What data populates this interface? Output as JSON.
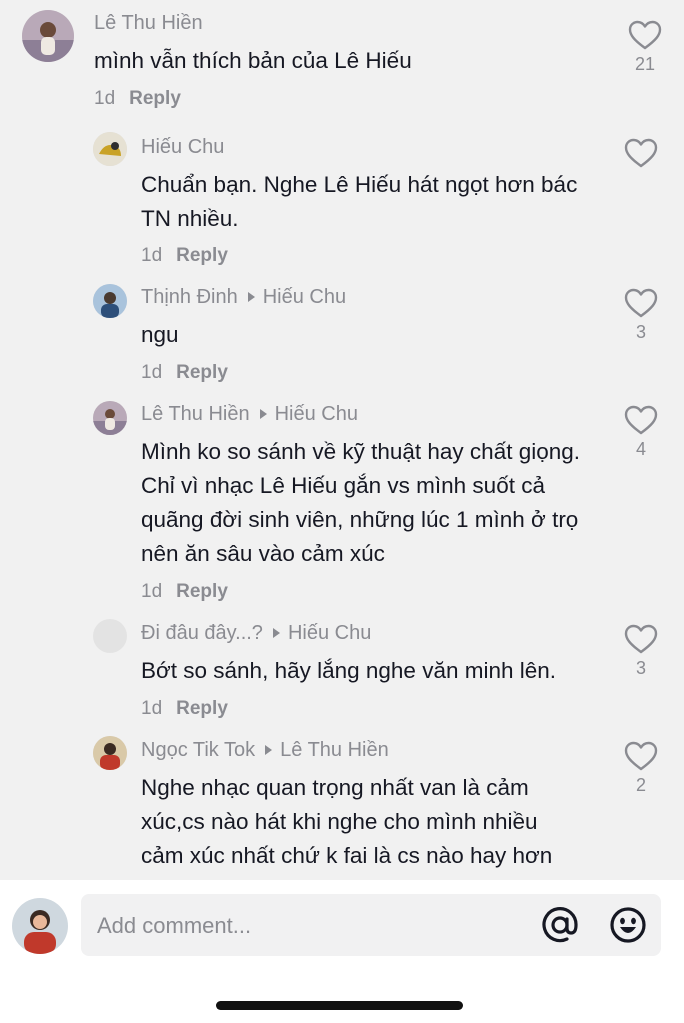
{
  "comments": [
    {
      "name": "Lê Thu Hiền",
      "text": "mình vẫn thích bản của Lê Hiếu",
      "time": "1d",
      "reply_label": "Reply",
      "likes": "21"
    },
    {
      "name": "Hiếu Chu",
      "text": "Chuẩn bạn. Nghe Lê Hiếu hát ngọt hơn bác TN nhiều.",
      "time": "1d",
      "reply_label": "Reply",
      "likes": ""
    },
    {
      "name": "Thịnh Đinh",
      "reply_to": "Hiếu Chu",
      "text": "ngu",
      "time": "1d",
      "reply_label": "Reply",
      "likes": "3"
    },
    {
      "name": "Lê Thu Hiền",
      "reply_to": "Hiếu Chu",
      "text": "Mình ko so sánh về kỹ thuật hay chất giọng. Chỉ vì nhạc Lê Hiếu gắn vs mình suốt cả quãng đời sinh viên, những lúc 1 mình ở trọ nên ăn sâu vào cảm xúc",
      "time": "1d",
      "reply_label": "Reply",
      "likes": "4"
    },
    {
      "name": "Đi đâu đây...?",
      "reply_to": "Hiếu Chu",
      "text": "Bớt so sánh, hãy lắng nghe văn minh lên.",
      "time": "1d",
      "reply_label": "Reply",
      "likes": "3"
    },
    {
      "name": "Ngọc Tik Tok",
      "reply_to": "Lê Thu Hiền",
      "text": "Nghe nhạc quan trọng nhất van là cảm xúc,cs nào hát khi nghe cho mình nhiều cảm xúc nhất chứ k fai là cs nào hay hơn",
      "time": "",
      "reply_label": "",
      "likes": "2"
    }
  ],
  "composer": {
    "placeholder": "Add comment..."
  },
  "icons": {
    "like": "heart-outline-icon",
    "mention": "at-sign-icon",
    "emoji": "smiley-face-icon"
  },
  "colors": {
    "background": "#f1f1f1",
    "secondary_text": "#8a8b91",
    "primary_text": "#161823"
  }
}
